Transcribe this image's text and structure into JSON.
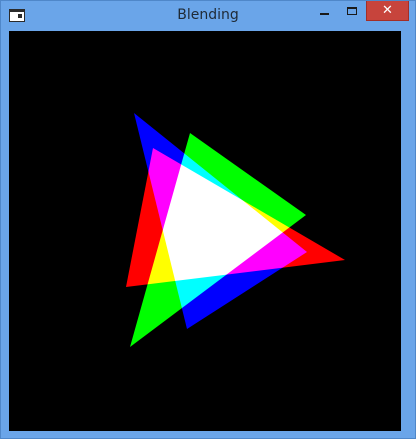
{
  "window": {
    "title": "Blending",
    "icon": "app-window-icon",
    "controls": {
      "minimize": "minimize-icon",
      "maximize": "maximize-icon",
      "close": "close-icon"
    }
  },
  "canvas": {
    "background": "#000000",
    "triangle_colors": [
      "#ff0000",
      "#00ff00",
      "#0000ff"
    ],
    "blend_mode": "additive"
  }
}
